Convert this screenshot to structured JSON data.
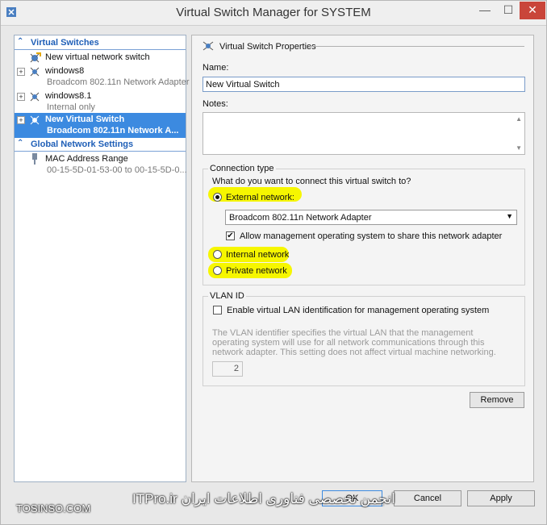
{
  "window": {
    "title": "Virtual Switch Manager for SYSTEM",
    "minimize_glyph": "—",
    "maximize_glyph": "☐",
    "close_glyph": "✕"
  },
  "left_pane": {
    "virtual_switches_header": "Virtual Switches",
    "new_item": "New virtual network switch",
    "switches": [
      {
        "name": "windows8",
        "detail": "Broadcom 802.11n Network Adapter"
      },
      {
        "name": "windows8.1",
        "detail": "Internal only"
      },
      {
        "name": "New Virtual Switch",
        "detail": "Broadcom 802.11n Network A..."
      }
    ],
    "global_header": "Global Network Settings",
    "mac_range_label": "MAC Address Range",
    "mac_range_value": "00-15-5D-01-53-00 to 00-15-5D-0..."
  },
  "properties": {
    "section_title": "Virtual Switch Properties",
    "name_label": "Name:",
    "name_value": "New Virtual Switch",
    "notes_label": "Notes:",
    "connection_type_label": "Connection type",
    "connection_question": "What do you want to connect this virtual switch to?",
    "external_label": "External network:",
    "external_adapter": "Broadcom 802.11n Network Adapter",
    "allow_mgmt_label": "Allow management operating system to share this network adapter",
    "internal_label": "Internal network",
    "private_label": "Private network",
    "selected_connection": "external",
    "vlan_group_label": "VLAN ID",
    "vlan_enable_label": "Enable virtual LAN identification for management operating system",
    "vlan_help": "The VLAN identifier specifies the virtual LAN that the management operating system will use for all network communications through this network adapter. This setting does not affect virtual machine networking.",
    "vlan_value": "2",
    "remove_button": "Remove"
  },
  "footer": {
    "ok_button": "OK",
    "cancel_button": "Cancel",
    "apply_button": "Apply"
  },
  "watermark": {
    "site": "TOSINSO.COM",
    "center_text": "انجمن تخصصی فناوری اطلاعات ایران ITPro.ir"
  },
  "colors": {
    "accent": "#3c8ae0",
    "header_text": "#1f5fb7",
    "highlight": "#f6f600",
    "close_button": "#c9453a"
  }
}
